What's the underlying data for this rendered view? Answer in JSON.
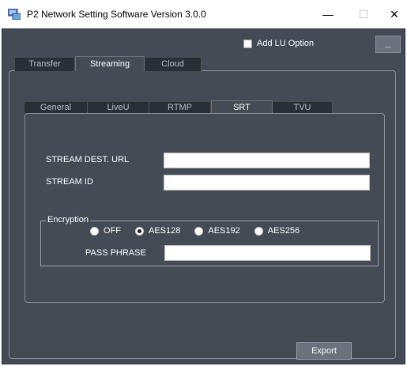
{
  "window": {
    "title": "P2 Network Setting Software  Version 3.0.0",
    "minimize_glyph": "—",
    "maximize_glyph": "☐",
    "close_glyph": "✕"
  },
  "top": {
    "add_lu_option_label": "Add LU Option",
    "add_lu_option_checked": false,
    "small_button_label": "_"
  },
  "main_tabs": [
    {
      "label": "Transfer",
      "active": false
    },
    {
      "label": "Streaming",
      "active": true
    },
    {
      "label": "Cloud",
      "active": false
    }
  ],
  "sub_tabs": [
    {
      "label": "General",
      "active": false
    },
    {
      "label": "LiveU",
      "active": false
    },
    {
      "label": "RTMP",
      "active": false
    },
    {
      "label": "SRT",
      "active": true
    },
    {
      "label": "TVU",
      "active": false
    }
  ],
  "srt": {
    "stream_dest_url_label": "STREAM DEST. URL",
    "stream_dest_url_value": "",
    "stream_id_label": "STREAM ID",
    "stream_id_value": "",
    "encryption_label": "Encryption",
    "encryption_options": [
      "OFF",
      "AES128",
      "AES192",
      "AES256"
    ],
    "encryption_selected": "AES128",
    "pass_phrase_label": "PASS PHRASE",
    "pass_phrase_value": ""
  },
  "actions": {
    "export_label": "Export"
  },
  "colors": {
    "background": "#444b55",
    "tab_inactive": "#2a2f36",
    "button": "#6a727d"
  }
}
